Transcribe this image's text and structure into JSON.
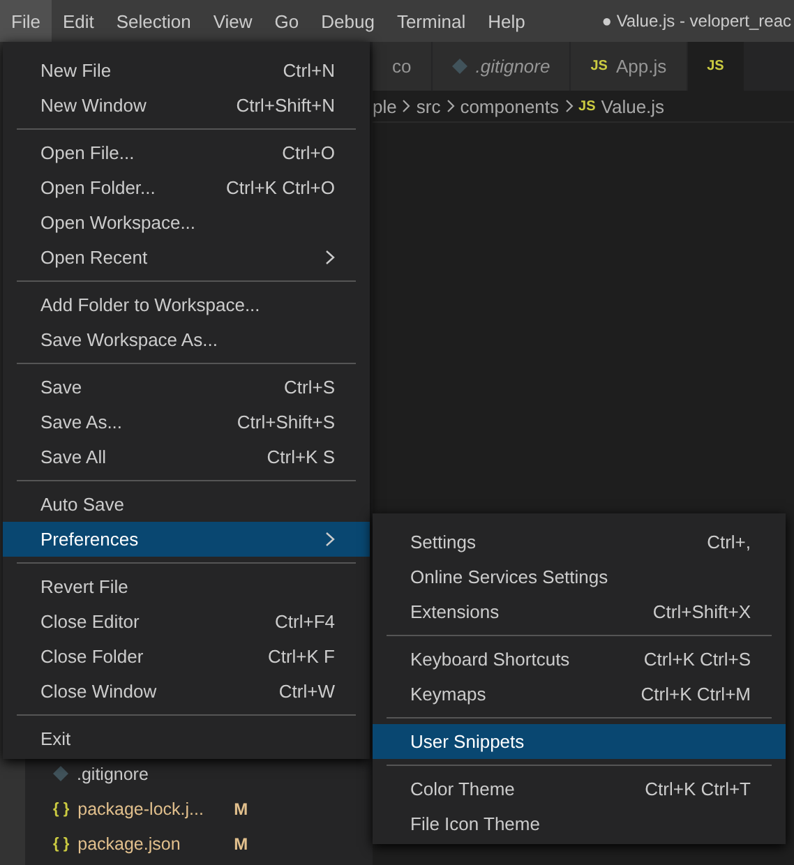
{
  "menubar": [
    {
      "label": "File",
      "selected": true
    },
    {
      "label": "Edit",
      "selected": false
    },
    {
      "label": "Selection",
      "selected": false
    },
    {
      "label": "View",
      "selected": false
    },
    {
      "label": "Go",
      "selected": false
    },
    {
      "label": "Debug",
      "selected": false
    },
    {
      "label": "Terminal",
      "selected": false
    },
    {
      "label": "Help",
      "selected": false
    }
  ],
  "window": {
    "title": "● Value.js - velopert_reac"
  },
  "tabs": [
    {
      "kind": "plain",
      "label": "co",
      "preview": false,
      "selected": false
    },
    {
      "kind": "git",
      "label": ".gitignore",
      "preview": true,
      "selected": false
    },
    {
      "kind": "js",
      "label": "App.js",
      "preview": false,
      "icon": "JS",
      "selected": false
    },
    {
      "kind": "js",
      "icon": "JS",
      "selected": true
    }
  ],
  "breadcrumb": [
    {
      "label": "ple"
    },
    {
      "label": "src"
    },
    {
      "label": "components"
    },
    {
      "label": "Value.js",
      "icon": "JS"
    }
  ],
  "explorer": [
    {
      "kind": "git",
      "label": ".gitignore",
      "modified": false
    },
    {
      "kind": "json",
      "label": "package-lock.j...",
      "icon": "{ }",
      "modified": true,
      "badge": "M"
    },
    {
      "kind": "json",
      "label": "package.json",
      "icon": "{ }",
      "modified": true,
      "badge": "M"
    }
  ],
  "file_menu": [
    {
      "kind": "item",
      "label": "New File",
      "shortcut": "Ctrl+N",
      "selected": false
    },
    {
      "kind": "item",
      "label": "New Window",
      "shortcut": "Ctrl+Shift+N",
      "selected": false
    },
    {
      "kind": "separator"
    },
    {
      "kind": "item",
      "label": "Open File...",
      "shortcut": "Ctrl+O",
      "selected": false
    },
    {
      "kind": "item",
      "label": "Open Folder...",
      "shortcut": "Ctrl+K Ctrl+O",
      "selected": false
    },
    {
      "kind": "item",
      "label": "Open Workspace...",
      "selected": false
    },
    {
      "kind": "submenu",
      "label": "Open Recent",
      "selected": false
    },
    {
      "kind": "separator"
    },
    {
      "kind": "item",
      "label": "Add Folder to Workspace...",
      "selected": false
    },
    {
      "kind": "item",
      "label": "Save Workspace As...",
      "selected": false
    },
    {
      "kind": "separator"
    },
    {
      "kind": "item",
      "label": "Save",
      "shortcut": "Ctrl+S",
      "selected": false
    },
    {
      "kind": "item",
      "label": "Save As...",
      "shortcut": "Ctrl+Shift+S",
      "selected": false
    },
    {
      "kind": "item",
      "label": "Save All",
      "shortcut": "Ctrl+K S",
      "selected": false
    },
    {
      "kind": "separator"
    },
    {
      "kind": "item",
      "label": "Auto Save",
      "selected": false
    },
    {
      "kind": "submenu",
      "label": "Preferences",
      "selected": true
    },
    {
      "kind": "separator"
    },
    {
      "kind": "item",
      "label": "Revert File",
      "selected": false
    },
    {
      "kind": "item",
      "label": "Close Editor",
      "shortcut": "Ctrl+F4",
      "selected": false
    },
    {
      "kind": "item",
      "label": "Close Folder",
      "shortcut": "Ctrl+K F",
      "selected": false
    },
    {
      "kind": "item",
      "label": "Close Window",
      "shortcut": "Ctrl+W",
      "selected": false
    },
    {
      "kind": "separator"
    },
    {
      "kind": "item",
      "label": "Exit",
      "selected": false
    }
  ],
  "preferences_menu": [
    {
      "kind": "item",
      "label": "Settings",
      "shortcut": "Ctrl+,",
      "selected": false
    },
    {
      "kind": "item",
      "label": "Online Services Settings",
      "selected": false
    },
    {
      "kind": "item",
      "label": "Extensions",
      "shortcut": "Ctrl+Shift+X",
      "selected": false
    },
    {
      "kind": "separator"
    },
    {
      "kind": "item",
      "label": "Keyboard Shortcuts",
      "shortcut": "Ctrl+K Ctrl+S",
      "selected": false
    },
    {
      "kind": "item",
      "label": "Keymaps",
      "shortcut": "Ctrl+K Ctrl+M",
      "selected": false
    },
    {
      "kind": "separator"
    },
    {
      "kind": "item",
      "label": "User Snippets",
      "selected": true
    },
    {
      "kind": "separator"
    },
    {
      "kind": "item",
      "label": "Color Theme",
      "shortcut": "Ctrl+K Ctrl+T",
      "selected": false
    },
    {
      "kind": "item",
      "label": "File Icon Theme",
      "selected": false
    }
  ]
}
